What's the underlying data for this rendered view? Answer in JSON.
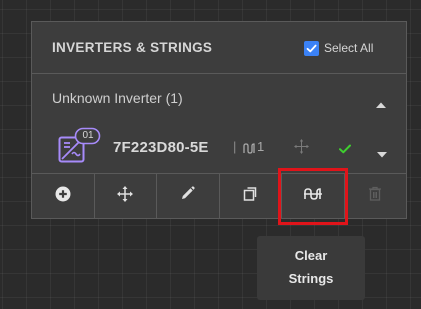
{
  "panel": {
    "title": "INVERTERS & STRINGS",
    "select_all_label": "Select All",
    "select_all_checked": true
  },
  "inverter_group": {
    "title": "Unknown Inverter (1)",
    "expanded": true
  },
  "device": {
    "badge": "01",
    "name": "7F223D80-5E",
    "separator": "|",
    "string_count": "1",
    "status": "ok"
  },
  "toolbar": {
    "buttons": [
      {
        "icon": "add-circle-icon",
        "state": "enabled"
      },
      {
        "icon": "move-icon",
        "state": "enabled"
      },
      {
        "icon": "pencil-icon",
        "state": "enabled"
      },
      {
        "icon": "copy-icon",
        "state": "enabled"
      },
      {
        "icon": "clear-strings-icon",
        "state": "hovered"
      },
      {
        "icon": "trash-icon",
        "state": "disabled"
      }
    ]
  },
  "tooltip": {
    "line1": "Clear",
    "line2": "Strings"
  },
  "colors": {
    "panel_bg": "#3d3d3d",
    "accent_blue": "#3b82f6",
    "device_icon_purple": "#a78bfa",
    "status_green": "#3ecf2f",
    "highlight_red": "#e0141a"
  }
}
